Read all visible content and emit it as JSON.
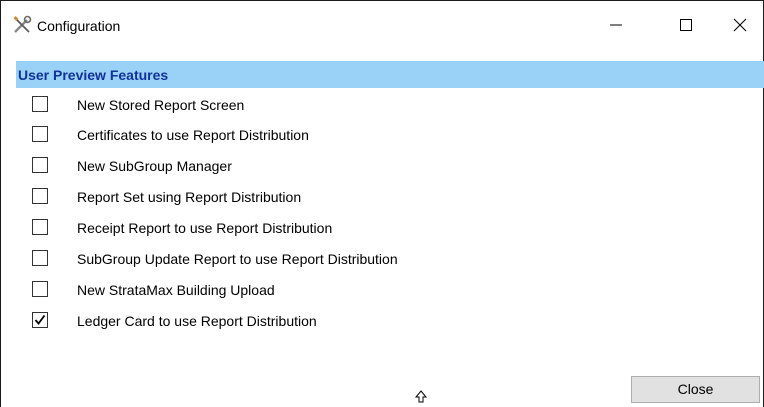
{
  "window": {
    "title": "Configuration",
    "app_icon": "tools-icon",
    "controls": [
      "minimize-icon",
      "maximize-icon",
      "close-icon"
    ]
  },
  "section": {
    "title": "User Preview Features",
    "header_color": "#99d1f7",
    "title_color": "#12329a"
  },
  "options": [
    {
      "label": "New Stored Report Screen",
      "checked": false
    },
    {
      "label": "Certificates to use Report Distribution",
      "checked": false
    },
    {
      "label": "New SubGroup Manager",
      "checked": false
    },
    {
      "label": "Report Set using Report Distribution",
      "checked": false
    },
    {
      "label": "Receipt Report to use Report Distribution",
      "checked": false
    },
    {
      "label": "SubGroup Update Report to use Report Distribution",
      "checked": false
    },
    {
      "label": "New StrataMax Building Upload",
      "checked": false
    },
    {
      "label": "Ledger Card to use Report Distribution",
      "checked": true
    }
  ],
  "footer": {
    "close_label": "Close"
  }
}
